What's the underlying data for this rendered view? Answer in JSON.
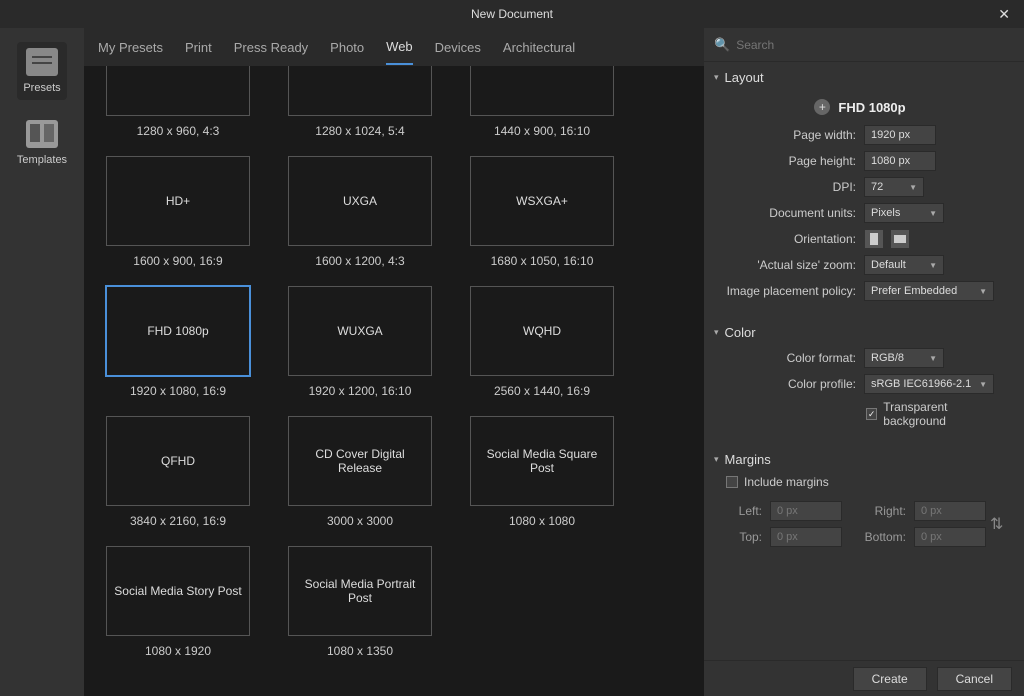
{
  "title": "New Document",
  "leftbar": {
    "presets": "Presets",
    "templates": "Templates"
  },
  "tabs": [
    "My Presets",
    "Print",
    "Press Ready",
    "Photo",
    "Web",
    "Devices",
    "Architectural"
  ],
  "active_tab": 4,
  "presets": [
    {
      "name": "",
      "dim": "1280 x 960, 4:3"
    },
    {
      "name": "",
      "dim": "1280 x 1024, 5:4"
    },
    {
      "name": "",
      "dim": "1440 x 900, 16:10"
    },
    {
      "name": "HD+",
      "dim": "1600 x 900, 16:9"
    },
    {
      "name": "UXGA",
      "dim": "1600 x 1200, 4:3"
    },
    {
      "name": "WSXGA+",
      "dim": "1680 x 1050, 16:10"
    },
    {
      "name": "FHD 1080p",
      "dim": "1920 x 1080, 16:9",
      "selected": true
    },
    {
      "name": "WUXGA",
      "dim": "1920 x 1200, 16:10"
    },
    {
      "name": "WQHD",
      "dim": "2560 x 1440, 16:9"
    },
    {
      "name": "QFHD",
      "dim": "3840 x 2160, 16:9"
    },
    {
      "name": "CD Cover Digital Release",
      "dim": "3000 x 3000"
    },
    {
      "name": "Social Media Square Post",
      "dim": "1080 x 1080"
    },
    {
      "name": "Social Media Story Post",
      "dim": "1080 x 1920"
    },
    {
      "name": "Social Media Portrait Post",
      "dim": "1080 x 1350"
    }
  ],
  "search_placeholder": "Search",
  "sections": {
    "layout": "Layout",
    "color": "Color",
    "margins": "Margins"
  },
  "layout": {
    "preset_name": "FHD 1080p",
    "page_width_label": "Page width:",
    "page_width": "1920 px",
    "page_height_label": "Page height:",
    "page_height": "1080 px",
    "dpi_label": "DPI:",
    "dpi": "72",
    "units_label": "Document units:",
    "units": "Pixels",
    "orientation_label": "Orientation:",
    "actual_size_label": "'Actual size' zoom:",
    "actual_size": "Default",
    "image_policy_label": "Image placement policy:",
    "image_policy": "Prefer Embedded"
  },
  "color": {
    "format_label": "Color format:",
    "format": "RGB/8",
    "profile_label": "Color profile:",
    "profile": "sRGB IEC61966-2.1",
    "transparent_label": "Transparent background",
    "transparent_checked": true
  },
  "margins": {
    "include_label": "Include margins",
    "include_checked": false,
    "left_label": "Left:",
    "right_label": "Right:",
    "top_label": "Top:",
    "bottom_label": "Bottom:",
    "value": "0 px"
  },
  "footer": {
    "create": "Create",
    "cancel": "Cancel"
  }
}
